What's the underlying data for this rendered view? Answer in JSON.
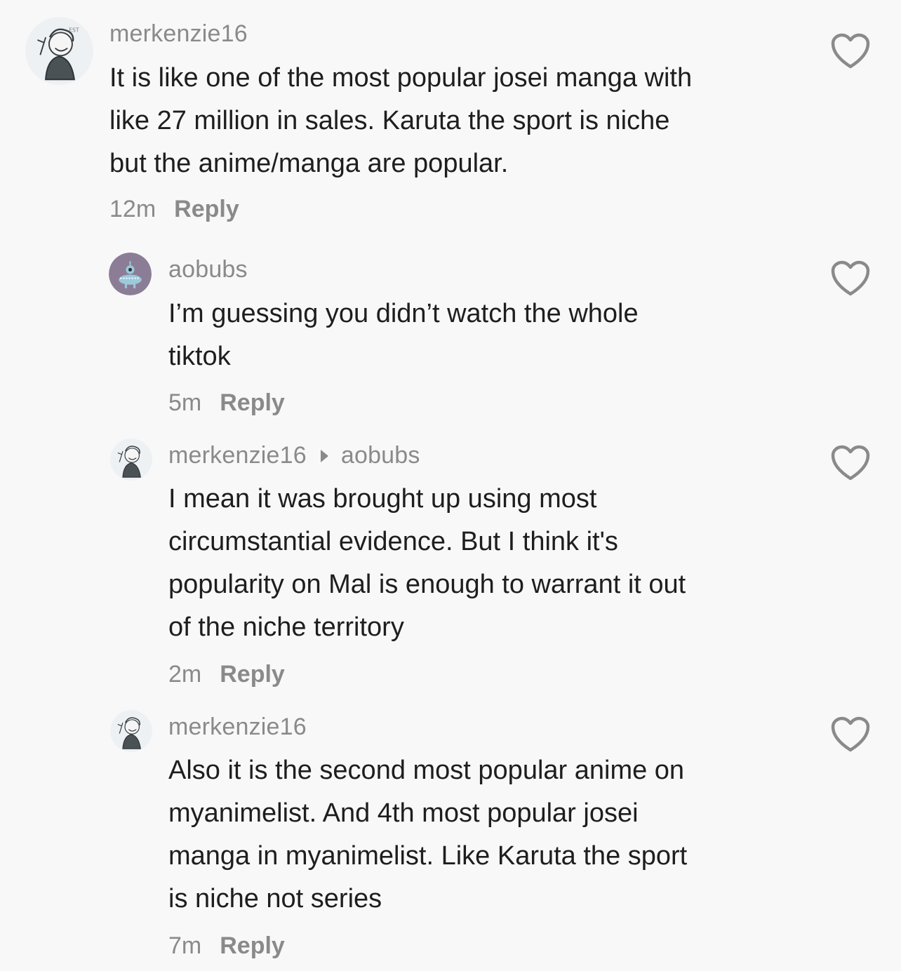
{
  "comments": [
    {
      "username": "merkenzie16",
      "text": "It is like one of the most popular josei manga with\nlike 27 million in sales. Karuta the sport is niche\nbut the anime/manga are popular.",
      "time": "12m",
      "reply_label": "Reply"
    },
    {
      "username": "aobubs",
      "text": "I’m guessing you didn’t watch the whole\ntiktok",
      "time": "5m",
      "reply_label": "Reply"
    },
    {
      "username": "merkenzie16",
      "reply_to": "aobubs",
      "text": "I mean it was brought up using most\ncircumstantial evidence. But I think it's\npopularity on Mal is enough to warrant it out\nof the niche territory",
      "time": "2m",
      "reply_label": "Reply"
    },
    {
      "username": "merkenzie16",
      "text": "Also it is the second most popular anime on\nmyanimelist. And 4th most popular josei\nmanga in myanimelist. Like Karuta the sport\nis niche not series",
      "time": "7m",
      "reply_label": "Reply"
    }
  ],
  "colors": {
    "background": "#f8f8f8",
    "text": "#1e1e1e",
    "secondary": "#8a8a8a",
    "aobubs_avatar": "#8c7d96"
  },
  "icons": {
    "like": "heart-outline-icon",
    "reply_to": "caret-right-icon"
  }
}
